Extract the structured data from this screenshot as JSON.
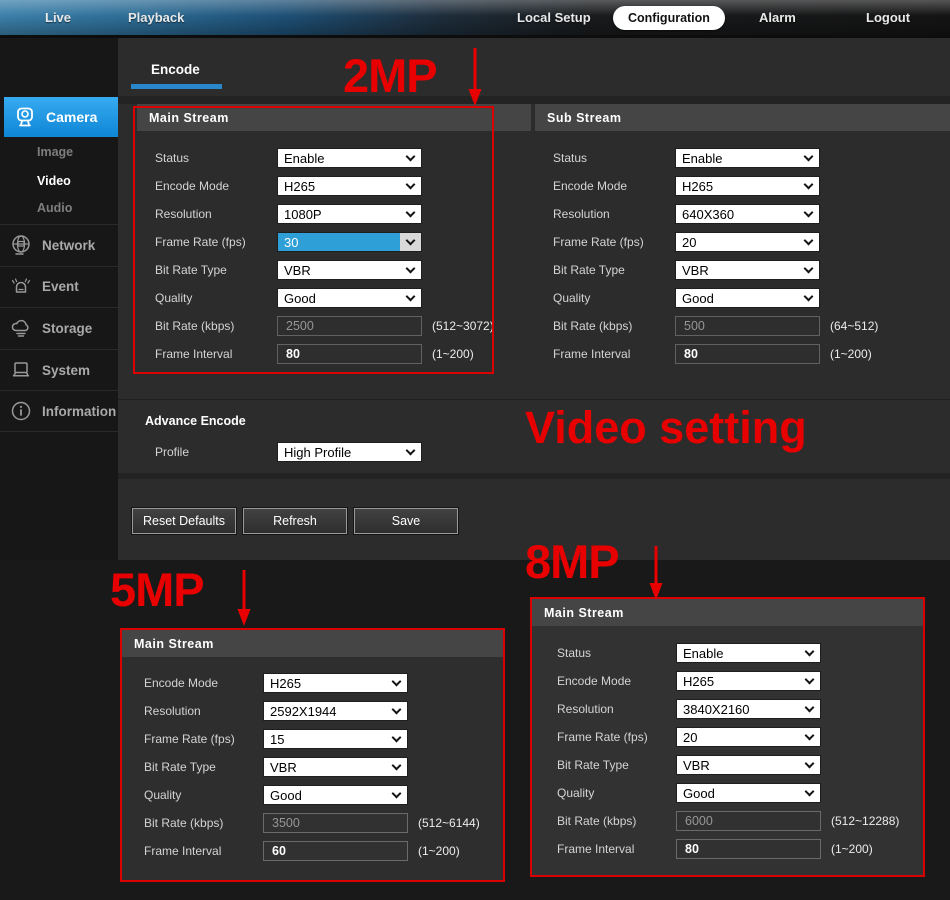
{
  "nav": {
    "items": [
      {
        "label": "Live"
      },
      {
        "label": "Playback"
      },
      {
        "label": "Local Setup"
      },
      {
        "label": "Configuration",
        "active": true
      },
      {
        "label": "Alarm"
      },
      {
        "label": "Logout"
      }
    ]
  },
  "sidebar": {
    "camera": {
      "label": "Camera",
      "selected": true
    },
    "sub_items": [
      {
        "label": "Image",
        "active": false
      },
      {
        "label": "Video",
        "active": true
      },
      {
        "label": "Audio",
        "active": false
      }
    ],
    "items": [
      {
        "label": "Network",
        "icon": "network-globe-icon"
      },
      {
        "label": "Event",
        "icon": "alarm-siren-icon"
      },
      {
        "label": "Storage",
        "icon": "cloud-storage-icon"
      },
      {
        "label": "System",
        "icon": "computer-icon"
      },
      {
        "label": "Information",
        "icon": "info-circle-icon"
      }
    ]
  },
  "tab": {
    "label": "Encode"
  },
  "advance": {
    "title": "Advance Encode",
    "profile_label": "Profile",
    "profile_value": "High Profile"
  },
  "buttons": {
    "reset": "Reset Defaults",
    "refresh": "Refresh",
    "save": "Save"
  },
  "annotations": {
    "top": "2MP",
    "middle": "Video setting",
    "bottom_left": "5MP",
    "bottom_right": "8MP"
  },
  "colors": {
    "accent_blue": "#2b87cc",
    "camera_highlight": "#1f9ce8",
    "select_highlight": "#2f9fd7",
    "annotation_red": "#e80000"
  },
  "panels": {
    "main_2mp": {
      "title": "Main Stream",
      "rows": [
        {
          "label": "Status",
          "type": "select",
          "value": "Enable"
        },
        {
          "label": "Encode Mode",
          "type": "select",
          "value": "H265"
        },
        {
          "label": "Resolution",
          "type": "select",
          "value": "1080P"
        },
        {
          "label": "Frame Rate (fps)",
          "type": "select",
          "value": "30",
          "highlight": true
        },
        {
          "label": "Bit Rate Type",
          "type": "select",
          "value": "VBR"
        },
        {
          "label": "Quality",
          "type": "select",
          "value": "Good"
        },
        {
          "label": "Bit Rate (kbps)",
          "type": "input",
          "value": "2500",
          "disabled": true,
          "hint": "(512~3072)"
        },
        {
          "label": "Frame Interval",
          "type": "input",
          "value": "80",
          "hint": "(1~200)"
        }
      ]
    },
    "sub_stream": {
      "title": "Sub Stream",
      "rows": [
        {
          "label": "Status",
          "type": "select",
          "value": "Enable"
        },
        {
          "label": "Encode Mode",
          "type": "select",
          "value": "H265"
        },
        {
          "label": "Resolution",
          "type": "select",
          "value": "640X360"
        },
        {
          "label": "Frame Rate (fps)",
          "type": "select",
          "value": "20"
        },
        {
          "label": "Bit Rate Type",
          "type": "select",
          "value": "VBR"
        },
        {
          "label": "Quality",
          "type": "select",
          "value": "Good"
        },
        {
          "label": "Bit Rate (kbps)",
          "type": "input",
          "value": "500",
          "disabled": true,
          "hint": "(64~512)"
        },
        {
          "label": "Frame Interval",
          "type": "input",
          "value": "80",
          "hint": "(1~200)"
        }
      ]
    },
    "main_5mp": {
      "title": "Main Stream",
      "rows": [
        {
          "label": "Encode Mode",
          "type": "select",
          "value": "H265"
        },
        {
          "label": "Resolution",
          "type": "select",
          "value": "2592X1944"
        },
        {
          "label": "Frame Rate (fps)",
          "type": "select",
          "value": "15"
        },
        {
          "label": "Bit Rate Type",
          "type": "select",
          "value": "VBR"
        },
        {
          "label": "Quality",
          "type": "select",
          "value": "Good"
        },
        {
          "label": "Bit Rate (kbps)",
          "type": "input",
          "value": "3500",
          "disabled": true,
          "hint": "(512~6144)"
        },
        {
          "label": "Frame Interval",
          "type": "input",
          "value": "60",
          "hint": "(1~200)"
        }
      ]
    },
    "main_8mp": {
      "title": "Main Stream",
      "rows": [
        {
          "label": "Status",
          "type": "select",
          "value": "Enable"
        },
        {
          "label": "Encode Mode",
          "type": "select",
          "value": "H265"
        },
        {
          "label": "Resolution",
          "type": "select",
          "value": "3840X2160"
        },
        {
          "label": "Frame Rate (fps)",
          "type": "select",
          "value": "20"
        },
        {
          "label": "Bit Rate Type",
          "type": "select",
          "value": "VBR"
        },
        {
          "label": "Quality",
          "type": "select",
          "value": "Good"
        },
        {
          "label": "Bit Rate (kbps)",
          "type": "input",
          "value": "6000",
          "disabled": true,
          "hint": "(512~12288)"
        },
        {
          "label": "Frame Interval",
          "type": "input",
          "value": "80",
          "hint": "(1~200)"
        }
      ]
    }
  }
}
